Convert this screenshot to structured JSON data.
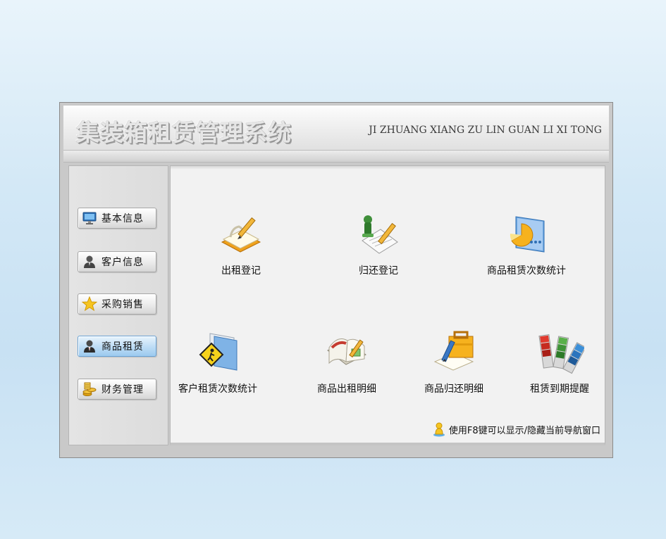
{
  "header": {
    "title": "集装箱租赁管理系统",
    "subtitle": "JI ZHUANG XIANG ZU LIN GUAN LI XI TONG"
  },
  "sidebar": {
    "items": [
      {
        "label": "基本信息",
        "icon": "monitor-icon"
      },
      {
        "label": "客户信息",
        "icon": "user-icon"
      },
      {
        "label": "采购销售",
        "icon": "star-icon"
      },
      {
        "label": "商品租赁",
        "icon": "manager-icon",
        "active": true
      },
      {
        "label": "财务管理",
        "icon": "coins-icon"
      }
    ]
  },
  "functions": [
    {
      "label": "出租登记",
      "icon": "notebook-pencil-icon"
    },
    {
      "label": "归还登记",
      "icon": "document-pencil-icon"
    },
    {
      "label": "商品租赁次数统计",
      "icon": "pie-chart-folder-icon"
    },
    {
      "label": "客户租赁次数统计",
      "icon": "sign-folder-icon"
    },
    {
      "label": "商品出租明细",
      "icon": "open-book-icon"
    },
    {
      "label": "商品归还明细",
      "icon": "briefcase-pencil-icon"
    },
    {
      "label": "租赁到期提醒",
      "icon": "color-swatch-icon"
    }
  ],
  "hint": {
    "text": "使用F8键可以显示/隐藏当前导航窗口",
    "icon": "info-person-icon"
  },
  "colors": {
    "active_nav": "#9ccaef",
    "background": "#d3e8f6"
  }
}
